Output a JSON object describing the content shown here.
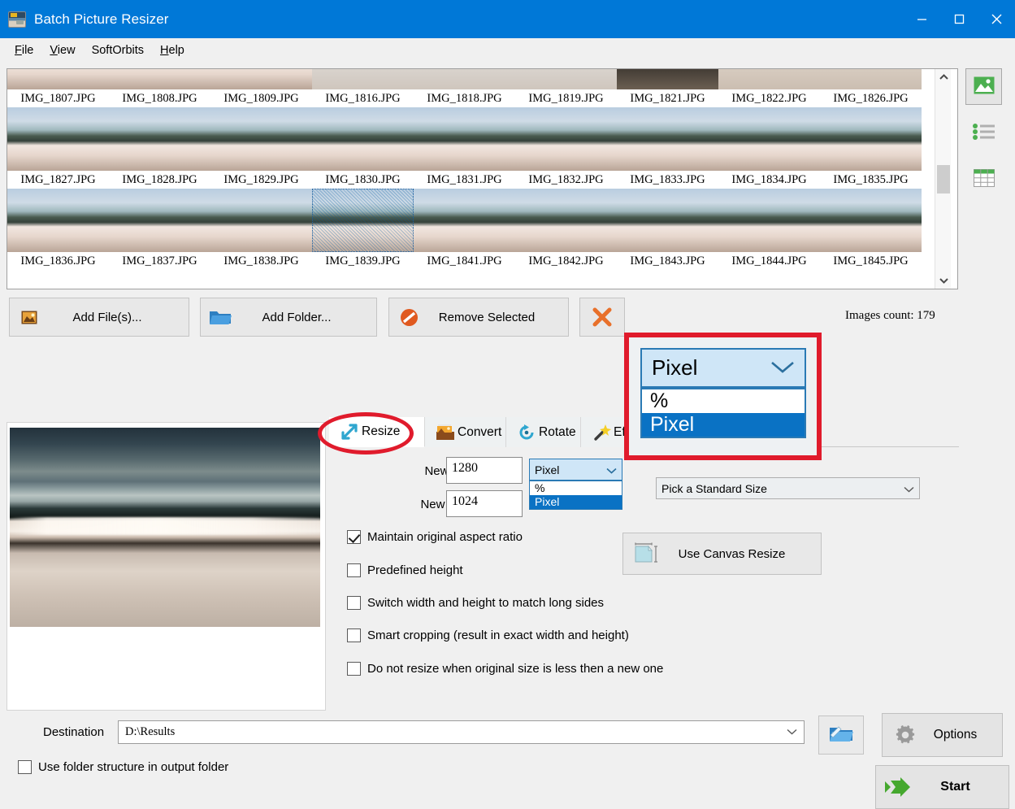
{
  "window": {
    "title": "Batch Picture Resizer",
    "app_icon": "picture-icon",
    "controls": {
      "minimize": "─",
      "maximize": "□",
      "close": "✕"
    }
  },
  "menu": [
    {
      "label": "File",
      "accel": "F"
    },
    {
      "label": "View",
      "accel": "V"
    },
    {
      "label": "SoftOrbits",
      "accel": ""
    },
    {
      "label": "Help",
      "accel": "H"
    }
  ],
  "thumbnails": {
    "rows": [
      [
        "IMG_1807.JPG",
        "IMG_1808.JPG",
        "IMG_1809.JPG",
        "IMG_1816.JPG",
        "IMG_1818.JPG",
        "IMG_1819.JPG",
        "IMG_1821.JPG",
        "IMG_1822.JPG",
        "IMG_1826.JPG"
      ],
      [
        "IMG_1827.JPG",
        "IMG_1828.JPG",
        "IMG_1829.JPG",
        "IMG_1830.JPG",
        "IMG_1831.JPG",
        "IMG_1832.JPG",
        "IMG_1833.JPG",
        "IMG_1834.JPG",
        "IMG_1835.JPG"
      ],
      [
        "IMG_1836.JPG",
        "IMG_1837.JPG",
        "IMG_1838.JPG",
        "IMG_1839.JPG",
        "IMG_1841.JPG",
        "IMG_1842.JPG",
        "IMG_1843.JPG",
        "IMG_1844.JPG",
        "IMG_1845.JPG"
      ]
    ],
    "selected_index": 3,
    "scrollbar": {
      "up": "chevron-up-icon",
      "down": "chevron-down-icon"
    }
  },
  "view_modes": [
    {
      "name": "thumbnail-view",
      "icon": "picture-icon",
      "active": true
    },
    {
      "name": "list-view",
      "icon": "list-icon",
      "active": false
    },
    {
      "name": "table-view",
      "icon": "grid-icon",
      "active": false
    }
  ],
  "file_bar": {
    "add_files": "Add File(s)...",
    "add_folder": "Add Folder...",
    "remove_selected": "Remove Selected",
    "clear_all": "clear-all-icon",
    "images_count": "Images count: 179"
  },
  "tabs": [
    {
      "label": "Resize",
      "icon": "resize-arrows-icon",
      "active": true
    },
    {
      "label": "Convert",
      "icon": "convert-icon",
      "active": false
    },
    {
      "label": "Rotate",
      "icon": "rotate-icon",
      "active": false
    },
    {
      "label": "Effe",
      "icon": "effects-wand-icon",
      "active": false
    }
  ],
  "resize_form": {
    "new_width_label": "New Width",
    "new_width_value": "1280",
    "new_height_label": "New Height",
    "new_height_value": "1024",
    "unit_combo": {
      "value": "Pixel",
      "options": [
        "%",
        "Pixel"
      ],
      "selected_option": "Pixel"
    },
    "standard_size": {
      "value": "Pick a Standard Size",
      "arrow": "chevron-down-icon"
    },
    "canvas_button": {
      "label": "Use Canvas Resize",
      "icon": "canvas-resize-icon"
    },
    "checkboxes": [
      {
        "label": "Maintain original aspect ratio",
        "checked": true
      },
      {
        "label": "Predefined height",
        "checked": false
      },
      {
        "label": "Switch width and height to match long sides",
        "checked": false
      },
      {
        "label": "Smart cropping (result in exact width and height)",
        "checked": false
      },
      {
        "label": "Do not resize when original size is less then a new one",
        "checked": false
      }
    ]
  },
  "callout": {
    "border_color": "#e01b2c",
    "combo_value": "Pixel",
    "options": [
      "%",
      "Pixel"
    ],
    "selected_option": "Pixel",
    "arrow": "chevron-down-icon"
  },
  "destination": {
    "label": "Destination",
    "value": "D:\\Results",
    "arrow": "chevron-down-icon",
    "folder_structure_label": "Use folder structure in output folder",
    "folder_structure_checked": false,
    "browse_icon": "browse-folder-icon"
  },
  "actions": {
    "options": {
      "label": "Options",
      "icon": "gear-icon"
    },
    "start": {
      "label": "Start",
      "icon": "green-arrow-icon"
    }
  },
  "colors": {
    "titlebar": "#0078d7",
    "accent_red": "#e01b2c",
    "select_blue": "#0a72c4",
    "combo_fill": "#cfe6f7",
    "window_bg": "#f0f0f0"
  }
}
